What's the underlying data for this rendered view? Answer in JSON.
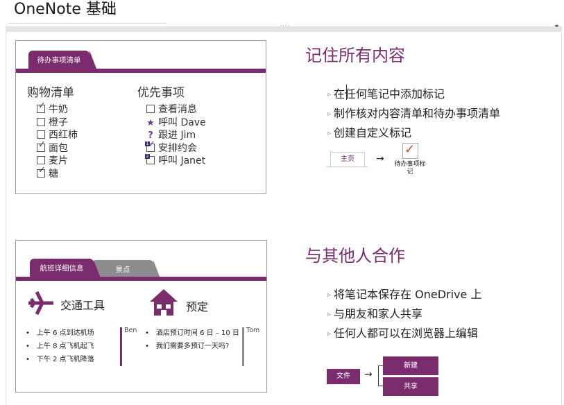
{
  "page": {
    "title": "OneNote 基础"
  },
  "card1": {
    "tab_label": "待办事项清单",
    "shopping": {
      "title": "购物清单",
      "items": [
        {
          "label": "牛奶",
          "checked": true
        },
        {
          "label": "橙子",
          "checked": false
        },
        {
          "label": "西红柿",
          "checked": false
        },
        {
          "label": "面包",
          "checked": true
        },
        {
          "label": "麦片",
          "checked": false
        },
        {
          "label": "糖",
          "checked": true
        }
      ]
    },
    "priority": {
      "title": "优先事项",
      "items": [
        {
          "label": "查看消息",
          "marker": "checkbox"
        },
        {
          "label": "呼叫 Dave",
          "marker": "star"
        },
        {
          "label": "跟进 Jim",
          "marker": "question"
        },
        {
          "label": "安排约会",
          "marker": "checkbox-checked-1"
        },
        {
          "label": "呼叫 Janet",
          "marker": "checkbox-2"
        }
      ],
      "badge_1": "1",
      "badge_2": "2"
    }
  },
  "section1": {
    "heading": "记住所有内容",
    "bullets": [
      "在任何笔记中添加标记",
      "制作核对内容清单和待办事项清单",
      "创建自定义标记"
    ],
    "home_tab": "主页",
    "todo_tag_label": "待办事项标记"
  },
  "card2": {
    "tabs": [
      "航班详细信息",
      "景点"
    ],
    "transport": {
      "title": "交通工具",
      "items": [
        "上午 6 点到达机场",
        "上午 8 点飞机起飞",
        "下午 2 点飞机降落"
      ],
      "side_name": "Ben"
    },
    "booking": {
      "title": "预定",
      "items": [
        "酒店预订时间 6 日 – 10 日",
        "我们需要多预订一天吗?"
      ],
      "side_name": "Tom"
    }
  },
  "section2": {
    "heading": "与其他人合作",
    "bullets": [
      "将笔记本保存在 OneDrive 上",
      "与朋友和家人共享",
      "任何人都可以在浏览器上编辑"
    ],
    "file_button": "文件",
    "new_button": "新建",
    "share_button": "共享"
  },
  "colors": {
    "accent": "#7b2c6f",
    "grey_tab": "#8c8c8c"
  }
}
